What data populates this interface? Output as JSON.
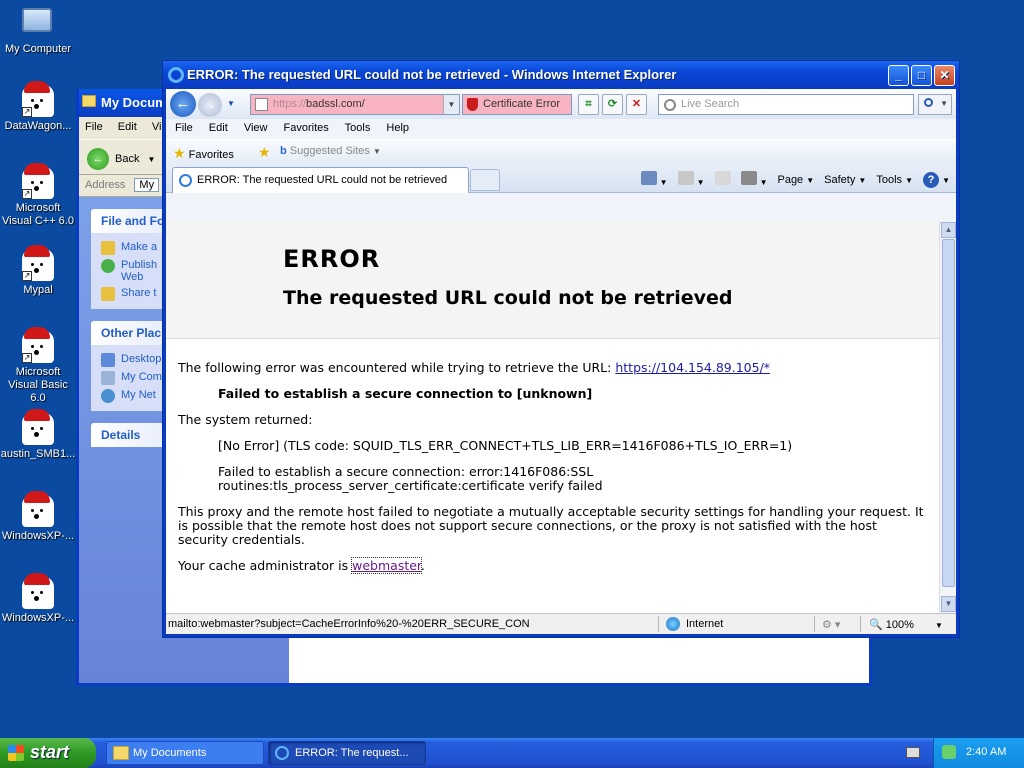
{
  "desktop": {
    "icons": [
      {
        "label": "My Computer"
      },
      {
        "label": "DataWagon..."
      },
      {
        "label": "Microsoft Visual C++ 6.0"
      },
      {
        "label": "Mypal"
      },
      {
        "label": "Microsoft Visual Basic 6.0"
      },
      {
        "label": "austin_SMB1..."
      },
      {
        "label": "WindowsXP-..."
      },
      {
        "label": "WindowsXP-..."
      }
    ]
  },
  "mydocs": {
    "title": "My Docum",
    "menu": [
      "File",
      "Edit",
      "Vi"
    ],
    "back_label": "Back",
    "address_label": "Address",
    "address_value": "My",
    "file_folder_head": "File and Fo",
    "file_tasks": [
      "Make a",
      "Publish Web",
      "Share t"
    ],
    "other_places_head": "Other Plac",
    "other_places": [
      "Desktop",
      "My Com",
      "My Net"
    ],
    "details_head": "Details"
  },
  "ie": {
    "title": "ERROR: The requested URL could not be retrieved - Windows Internet Explorer",
    "address_scheme": "https://",
    "address_host": "badssl.com/",
    "cert_error": "Certificate Error",
    "search_placeholder": "Live Search",
    "menu": [
      "File",
      "Edit",
      "View",
      "Favorites",
      "Tools",
      "Help"
    ],
    "favorites_label": "Favorites",
    "suggested_sites": "Suggested Sites",
    "tab_title": "ERROR: The requested URL could not be retrieved",
    "cmd_page": "Page",
    "cmd_safety": "Safety",
    "cmd_tools": "Tools",
    "status_text": "mailto:webmaster?subject=CacheErrorInfo%20-%20ERR_SECURE_CON",
    "zone": "Internet",
    "zoom": "100%"
  },
  "page": {
    "h1": "ERROR",
    "h2": "The requested URL could not be retrieved",
    "intro": "The following error was encountered while trying to retrieve the URL:",
    "url": "https://104.154.89.105/*",
    "failed": "Failed to establish a secure connection to [unknown]",
    "system_returned": "The system returned:",
    "tls_code": "[No Error] (TLS code: SQUID_TLS_ERR_CONNECT+TLS_LIB_ERR=1416F086+TLS_IO_ERR=1)",
    "detail_line1": "Failed to establish a secure connection: error:1416F086:SSL",
    "detail_line2": "routines:tls_process_server_certificate:certificate verify failed",
    "proxy_msg": "This proxy and the remote host failed to negotiate a mutually acceptable security settings for handling your request. It is possible that the remote host does not support secure connections, or the proxy is not satisfied with the host security credentials.",
    "cache_admin": "Your cache administrator is",
    "webmaster": "webmaster",
    "period": "."
  },
  "taskbar": {
    "start": "start",
    "items": [
      "My Documents",
      "ERROR: The request..."
    ],
    "clock": "2:40 AM"
  }
}
